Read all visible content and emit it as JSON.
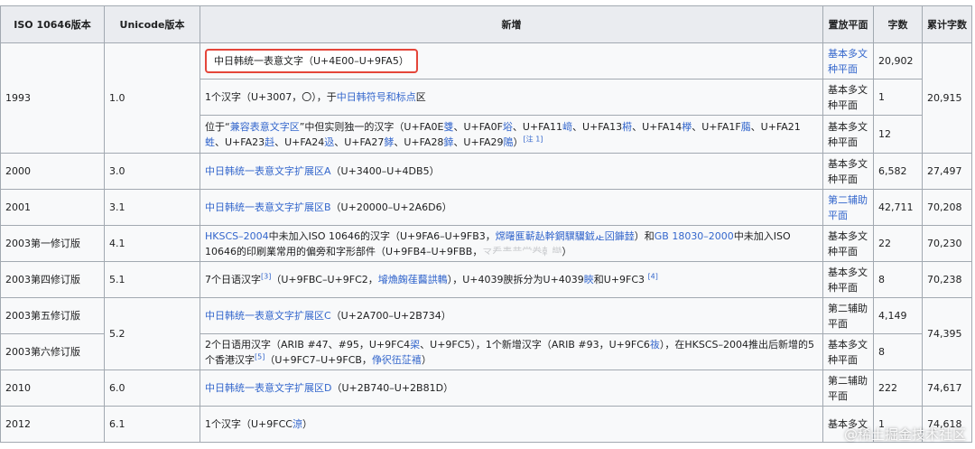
{
  "headers": {
    "iso": "ISO 10646版本",
    "unicode": "Unicode版本",
    "added": "新增",
    "plane": "置放平面",
    "count": "字数",
    "cumulative": "累计字数"
  },
  "rows": {
    "r1993a": {
      "iso": "1993",
      "unicode": "1.0",
      "added_link": "中日韩统一表意文字",
      "added_rest": "（U+4E00–U+9FA5）",
      "plane": "基本多文种平面",
      "count": "20,902",
      "cumulative": "20,915"
    },
    "r1993b": {
      "added_pre": "1个汉字（U+3007，〇），于",
      "added_link": "中日韩符号和标点",
      "added_post": "区",
      "plane": "基本多文种平面",
      "count": "1"
    },
    "r1993c": {
      "added_pre": "位于“",
      "added_link": "兼容表意文字区",
      "added_mid": "”中但实则独一的汉字（U+FA0E",
      "chars": [
        "﨎",
        "﨏",
        "﨑",
        "﨓",
        "﨔",
        "﨟",
        "﨡",
        "﨣",
        "﨤",
        "﨧",
        "﨨",
        "﨩"
      ],
      "codes": [
        "、U+FA0F",
        "、U+FA11",
        "、U+FA13",
        "、U+FA14",
        "、U+FA1F",
        "、U+FA21",
        "、U+FA23",
        "、U+FA24",
        "、U+FA27",
        "、U+FA28",
        "、U+FA29"
      ],
      "added_end": "）",
      "note": "[注 1]",
      "plane": "基本多文种平面",
      "count": "12"
    },
    "r2000": {
      "iso": "2000",
      "unicode": "3.0",
      "added_link": "中日韩统一表意文字扩展区A",
      "added_rest": "（U+3400–U+4DB5）",
      "plane": "基本多文种平面",
      "count": "6,582",
      "cumulative": "27,497"
    },
    "r2001": {
      "iso": "2001",
      "unicode": "3.1",
      "added_link": "中日韩统一表意文字扩展区B",
      "added_rest": "（U+20000–U+2A6D6）",
      "plane": "第二辅助平面",
      "count": "42,711",
      "cumulative": "70,208"
    },
    "r2003a": {
      "iso": "2003第一修订版",
      "unicode": "4.1",
      "added_link1": "HKSCS–2004",
      "added_t1": "中未加入ISO 10646的汉字（U+9FA6–U+9FB3，",
      "added_chars1": "龦龧龨龩龪龫龬龭龮龯龰龱龲龳",
      "added_t2": "）和",
      "added_link2": "GB 18030–2000",
      "added_t3": "中未加入ISO 10646的印刷業常用的偏旁和字形部件（U+9FB4–U+9FBB，",
      "added_chars2": "龴龵龶龷龸龹龺龻",
      "added_t4": "）",
      "plane": "基本多文种平面",
      "count": "22",
      "cumulative": "70,230"
    },
    "r2003d": {
      "iso": "2003第四修订版",
      "unicode": "5.1",
      "added_t1": "7个日语汉字",
      "sup1": "[3]",
      "added_t2": "（U+9FBC–U+9FC2，",
      "added_chars": "龼龽龾龿鿀鿁鿂",
      "added_t3": "），U+4039腴拆分为U+4039",
      "added_char2": "䀹",
      "added_t4": "和U+9FC3",
      "sup2": "[4]",
      "plane": "基本多文种平面",
      "count": "8",
      "cumulative": "70,238"
    },
    "r2003e": {
      "iso": "2003第五修订版",
      "unicode": "5.2",
      "added_link": "中日韩统一表意文字扩展区C",
      "added_rest": "（U+2A700–U+2B734）",
      "plane": "第二辅助平面",
      "count": "4,149",
      "cumulative": "74,395"
    },
    "r2003f": {
      "iso": "2003第六修订版",
      "added_t1": "2个日语用汉字（ARIB #47、#95，U+9FC4",
      "added_c1": "鿄",
      "added_t2": "、U+9FC5",
      "added_t3": "），1个新增汉字（ARIB #93，U+9FC6",
      "added_c2": "鿆",
      "added_t4": "），在HKSCS–2004推出后新增的5个香港汉字",
      "sup": "[5]",
      "added_t5": "（U+9FC7–U+9FCB，",
      "added_chars": "鿇鿈鿉鿊鿋",
      "added_t6": "）",
      "plane": "基本多文种平面",
      "count": "8"
    },
    "r2010": {
      "iso": "2010",
      "unicode": "6.0",
      "added_link": "中日韩统一表意文字扩展区D",
      "added_rest": "（U+2B740–U+2B81D）",
      "plane": "第二辅助平面",
      "count": "222",
      "cumulative": "74,617"
    },
    "r2012": {
      "iso": "2012",
      "unicode": "6.1",
      "added_t1": "1个汉字（U+9FCC",
      "added_char": "鿌",
      "added_t2": "）",
      "plane": "基本多文",
      "count": "1",
      "cumulative": "74,618"
    }
  },
  "watermark": "@稀土掘金技术社区"
}
